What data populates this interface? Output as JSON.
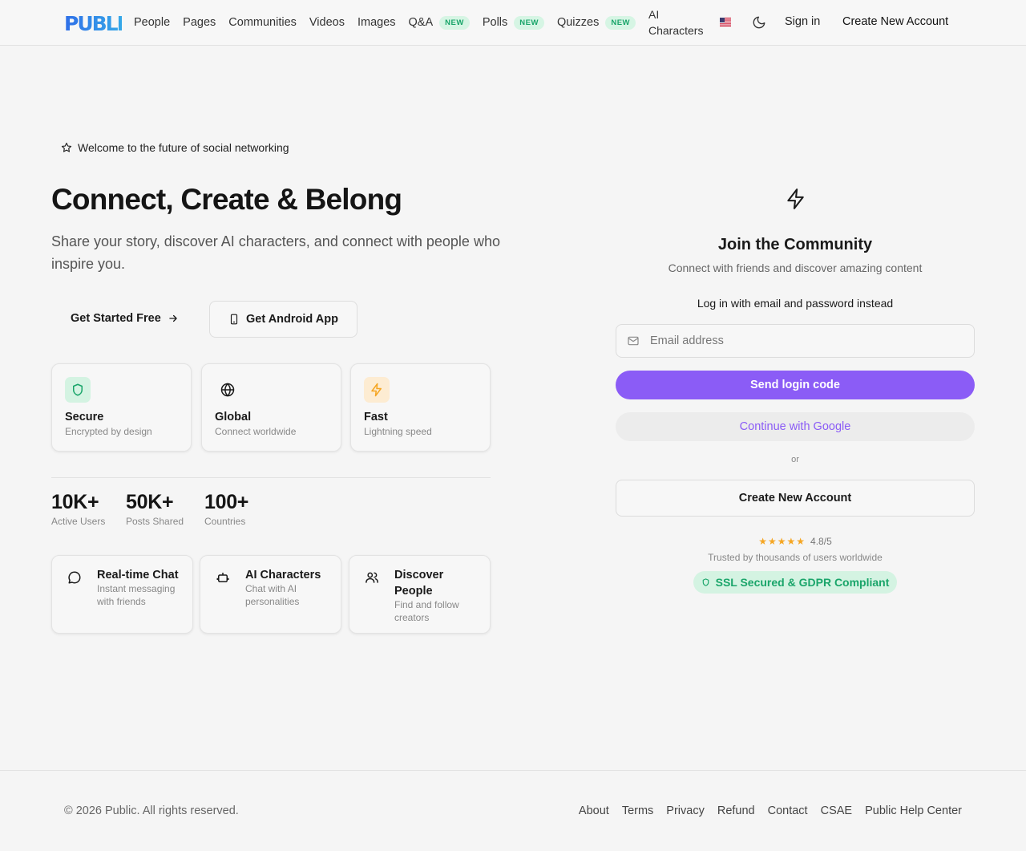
{
  "header": {
    "logo_text": "PUBLIC",
    "nav": [
      {
        "label": "People",
        "badge": ""
      },
      {
        "label": "Pages",
        "badge": ""
      },
      {
        "label": "Communities",
        "badge": ""
      },
      {
        "label": "Videos",
        "badge": ""
      },
      {
        "label": "Images",
        "badge": ""
      },
      {
        "label": "Q&A",
        "badge": "NEW"
      },
      {
        "label": "Polls",
        "badge": "NEW"
      },
      {
        "label": "Quizzes",
        "badge": "NEW"
      },
      {
        "label": "AI Characters",
        "badge": ""
      }
    ],
    "signin_label": "Sign in",
    "create_label": "Create New Account"
  },
  "hero": {
    "welcome": "Welcome to the future of social networking",
    "title": "Connect, Create & Belong",
    "subtitle": "Share your story, discover AI characters, and connect with people who inspire you.",
    "get_started": "Get Started Free",
    "android": "Get Android App"
  },
  "features": [
    {
      "title": "Secure",
      "subtitle": "Encrypted by design",
      "icon": "shield-icon"
    },
    {
      "title": "Global",
      "subtitle": "Connect worldwide",
      "icon": "globe-icon"
    },
    {
      "title": "Fast",
      "subtitle": "Lightning speed",
      "icon": "bolt-icon"
    }
  ],
  "stats": [
    {
      "value": "10K+",
      "label": "Active Users"
    },
    {
      "value": "50K+",
      "label": "Posts Shared"
    },
    {
      "value": "100+",
      "label": "Countries"
    }
  ],
  "mini_features": [
    {
      "title": "Real-time Chat",
      "subtitle": "Instant messaging with friends",
      "icon": "chat-icon"
    },
    {
      "title": "AI Characters",
      "subtitle": "Chat with AI personalities",
      "icon": "robot-icon"
    },
    {
      "title": "Discover People",
      "subtitle": "Find and follow creators",
      "icon": "users-icon"
    }
  ],
  "join": {
    "title": "Join the Community",
    "subtitle": "Connect with friends and discover amazing content",
    "login_link": "Log in with email and password instead",
    "email_placeholder": "Email address",
    "send_code": "Send login code",
    "google": "Continue with Google",
    "or": "or",
    "create": "Create New Account",
    "rating": "4.8/5",
    "stars": "★★★★★",
    "trusted": "Trusted by thousands of users worldwide",
    "ssl": "SSL Secured & GDPR Compliant"
  },
  "footer": {
    "copyright": "© 2026 Public. All rights reserved.",
    "links": [
      "About",
      "Terms",
      "Privacy",
      "Refund",
      "Contact",
      "CSAE",
      "Public Help Center"
    ]
  },
  "colors": {
    "accent": "#8b5cf6",
    "success": "#1aa56a",
    "star": "#f5a623",
    "logo_blue": "#3b82f6"
  }
}
